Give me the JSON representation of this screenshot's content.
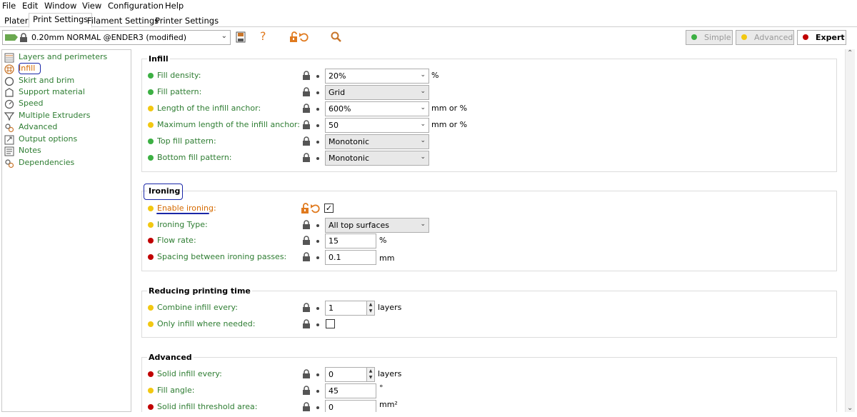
{
  "menu": [
    "File",
    "Edit",
    "Window",
    "View",
    "Configuration",
    "Help"
  ],
  "tabs": [
    "Plater",
    "Print Settings",
    "Filament Settings",
    "Printer Settings"
  ],
  "active_tab": "Print Settings",
  "preset": {
    "name": "0.20mm NORMAL @ENDER3 (modified)"
  },
  "toolbar": {
    "help": "?"
  },
  "modes": {
    "simple": "Simple",
    "advanced": "Advanced",
    "expert": "Expert"
  },
  "colors": {
    "green": "#3cb043",
    "yellow": "#f2c811",
    "red": "#c00000",
    "orange": "#e07a1f",
    "label_green": "#2e7d32"
  },
  "sidebar": [
    {
      "label": "Layers and perimeters",
      "icon": "layers-icon"
    },
    {
      "label": "Infill",
      "icon": "infill-icon"
    },
    {
      "label": "Skirt and brim",
      "icon": "skirt-icon"
    },
    {
      "label": "Support material",
      "icon": "support-icon"
    },
    {
      "label": "Speed",
      "icon": "speed-icon"
    },
    {
      "label": "Multiple Extruders",
      "icon": "extruder-icon"
    },
    {
      "label": "Advanced",
      "icon": "advanced-icon"
    },
    {
      "label": "Output options",
      "icon": "output-icon"
    },
    {
      "label": "Notes",
      "icon": "notes-icon"
    },
    {
      "label": "Dependencies",
      "icon": "dependencies-icon"
    }
  ],
  "groups": {
    "infill": {
      "title": "Infill",
      "rows": [
        {
          "label": "Fill density:",
          "value": "20%",
          "unit": "%",
          "level": "green"
        },
        {
          "label": "Fill pattern:",
          "value": "Grid",
          "unit": "",
          "level": "green"
        },
        {
          "label": "Length of the infill anchor:",
          "value": "600%",
          "unit": "mm or %",
          "level": "yellow"
        },
        {
          "label": "Maximum length of the infill anchor:",
          "value": "50",
          "unit": "mm or %",
          "level": "yellow"
        },
        {
          "label": "Top fill pattern:",
          "value": "Monotonic",
          "unit": "",
          "level": "green"
        },
        {
          "label": "Bottom fill pattern:",
          "value": "Monotonic",
          "unit": "",
          "level": "green"
        }
      ]
    },
    "ironing": {
      "title": "Ironing",
      "rows": [
        {
          "label": "Enable ironing:",
          "checked": true,
          "level": "yellow"
        },
        {
          "label": "Ironing Type:",
          "value": "All top surfaces",
          "level": "yellow"
        },
        {
          "label": "Flow rate:",
          "value": "15",
          "unit": "%",
          "level": "red"
        },
        {
          "label": "Spacing between ironing passes:",
          "value": "0.1",
          "unit": "mm",
          "level": "red"
        }
      ]
    },
    "reducing": {
      "title": "Reducing printing time",
      "rows": [
        {
          "label": "Combine infill every:",
          "value": "1",
          "unit": "layers",
          "level": "yellow"
        },
        {
          "label": "Only infill where needed:",
          "checked": false,
          "level": "yellow"
        }
      ]
    },
    "advanced": {
      "title": "Advanced",
      "rows": [
        {
          "label": "Solid infill every:",
          "value": "0",
          "unit": "layers",
          "level": "red"
        },
        {
          "label": "Fill angle:",
          "value": "45",
          "unit": "°",
          "level": "yellow"
        },
        {
          "label": "Solid infill threshold area:",
          "value": "0",
          "unit": "mm²",
          "level": "red"
        }
      ]
    }
  }
}
